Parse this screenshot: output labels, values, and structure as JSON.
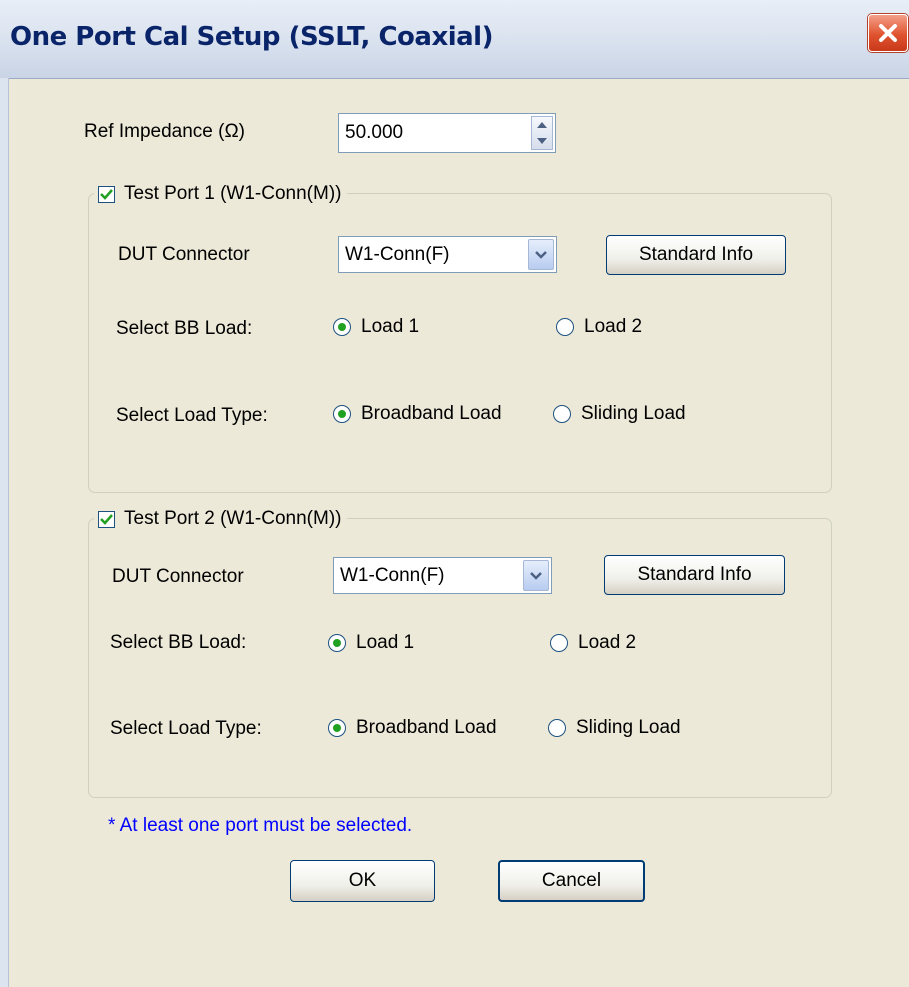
{
  "window": {
    "title": "One Port Cal Setup (SSLT, Coaxial)",
    "close_icon": "close-icon"
  },
  "ref_impedance": {
    "label": "Ref Impedance (Ω)",
    "value": "50.000"
  },
  "port1": {
    "checked": true,
    "title": "Test Port 1 (W1-Conn(M))",
    "dut_connector_label": "DUT Connector",
    "dut_connector_value": "W1-Conn(F)",
    "standard_info_label": "Standard Info",
    "bb_load_label": "Select BB Load:",
    "bb_load_options": [
      "Load 1",
      "Load 2"
    ],
    "bb_load_selected": "Load 1",
    "load_type_label": "Select Load Type:",
    "load_type_options": [
      "Broadband Load",
      "Sliding Load"
    ],
    "load_type_selected": "Broadband Load"
  },
  "port2": {
    "checked": true,
    "title": "Test Port 2 (W1-Conn(M))",
    "dut_connector_label": "DUT Connector",
    "dut_connector_value": "W1-Conn(F)",
    "standard_info_label": "Standard Info",
    "bb_load_label": "Select BB Load:",
    "bb_load_options": [
      "Load 1",
      "Load 2"
    ],
    "bb_load_selected": "Load 1",
    "load_type_label": "Select Load Type:",
    "load_type_options": [
      "Broadband Load",
      "Sliding Load"
    ],
    "load_type_selected": "Broadband Load"
  },
  "note": "* At least one port must be selected.",
  "buttons": {
    "ok": "OK",
    "cancel": "Cancel"
  },
  "colors": {
    "note": "#0000FF",
    "radio_dot": "#21A121",
    "title_text": "#0A246A",
    "close_button": "#E0532F"
  }
}
